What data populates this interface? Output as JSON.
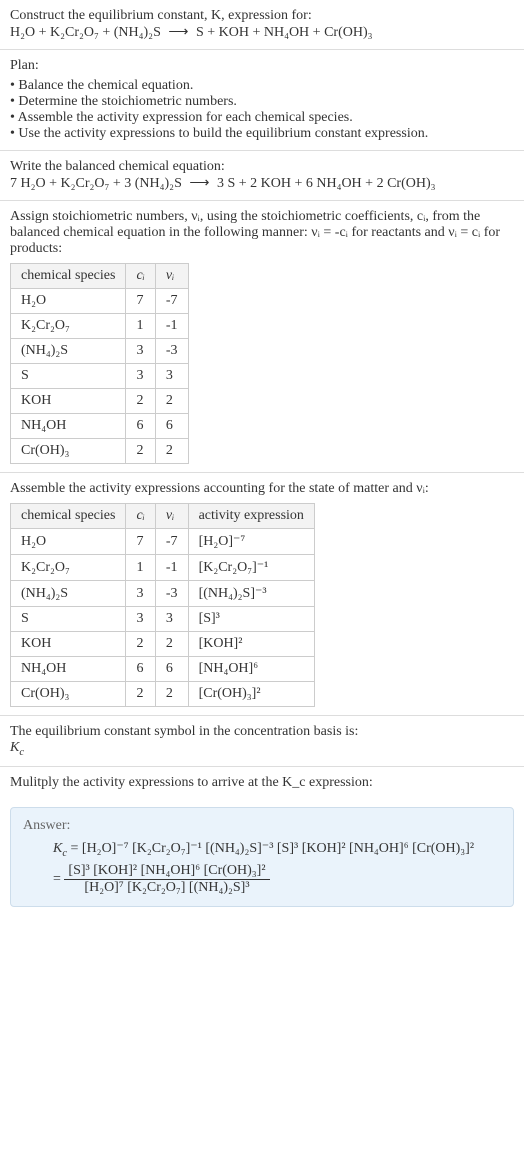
{
  "intro": {
    "line1": "Construct the equilibrium constant, K, expression for:",
    "reaction_lhs": "H₂O + K₂Cr₂O₇ + (NH₄)₂S",
    "arrow": "⟶",
    "reaction_rhs": "S + KOH + NH₄OH + Cr(OH)₃"
  },
  "plan": {
    "title": "Plan:",
    "items": [
      "Balance the chemical equation.",
      "Determine the stoichiometric numbers.",
      "Assemble the activity expression for each chemical species.",
      "Use the activity expressions to build the equilibrium constant expression."
    ]
  },
  "balanced": {
    "title": "Write the balanced chemical equation:",
    "lhs": "7 H₂O + K₂Cr₂O₇ + 3 (NH₄)₂S",
    "arrow": "⟶",
    "rhs": "3 S + 2 KOH + 6 NH₄OH + 2 Cr(OH)₃"
  },
  "stoich": {
    "intro": "Assign stoichiometric numbers, νᵢ, using the stoichiometric coefficients, cᵢ, from the balanced chemical equation in the following manner: νᵢ = -cᵢ for reactants and νᵢ = cᵢ for products:",
    "headers": [
      "chemical species",
      "cᵢ",
      "νᵢ"
    ],
    "rows": [
      {
        "sp": "H₂O",
        "c": "7",
        "v": "-7"
      },
      {
        "sp": "K₂Cr₂O₇",
        "c": "1",
        "v": "-1"
      },
      {
        "sp": "(NH₄)₂S",
        "c": "3",
        "v": "-3"
      },
      {
        "sp": "S",
        "c": "3",
        "v": "3"
      },
      {
        "sp": "KOH",
        "c": "2",
        "v": "2"
      },
      {
        "sp": "NH₄OH",
        "c": "6",
        "v": "6"
      },
      {
        "sp": "Cr(OH)₃",
        "c": "2",
        "v": "2"
      }
    ]
  },
  "activity": {
    "intro": "Assemble the activity expressions accounting for the state of matter and νᵢ:",
    "headers": [
      "chemical species",
      "cᵢ",
      "νᵢ",
      "activity expression"
    ],
    "rows": [
      {
        "sp": "H₂O",
        "c": "7",
        "v": "-7",
        "a": "[H₂O]⁻⁷"
      },
      {
        "sp": "K₂Cr₂O₇",
        "c": "1",
        "v": "-1",
        "a": "[K₂Cr₂O₇]⁻¹"
      },
      {
        "sp": "(NH₄)₂S",
        "c": "3",
        "v": "-3",
        "a": "[(NH₄)₂S]⁻³"
      },
      {
        "sp": "S",
        "c": "3",
        "v": "3",
        "a": "[S]³"
      },
      {
        "sp": "KOH",
        "c": "2",
        "v": "2",
        "a": "[KOH]²"
      },
      {
        "sp": "NH₄OH",
        "c": "6",
        "v": "6",
        "a": "[NH₄OH]⁶"
      },
      {
        "sp": "Cr(OH)₃",
        "c": "2",
        "v": "2",
        "a": "[Cr(OH)₃]²"
      }
    ]
  },
  "kc_symbol": {
    "line": "The equilibrium constant symbol in the concentration basis is:",
    "sym": "K_c"
  },
  "multiply": {
    "line": "Mulitply the activity expressions to arrive at the K_c expression:"
  },
  "answer": {
    "label": "Answer:",
    "line1": "K_c = [H₂O]⁻⁷ [K₂Cr₂O₇]⁻¹ [(NH₄)₂S]⁻³ [S]³ [KOH]² [NH₄OH]⁶ [Cr(OH)₃]²",
    "frac_num": "[S]³ [KOH]² [NH₄OH]⁶ [Cr(OH)₃]²",
    "frac_den": "[H₂O]⁷ [K₂Cr₂O₇] [(NH₄)₂S]³",
    "equals": "="
  }
}
